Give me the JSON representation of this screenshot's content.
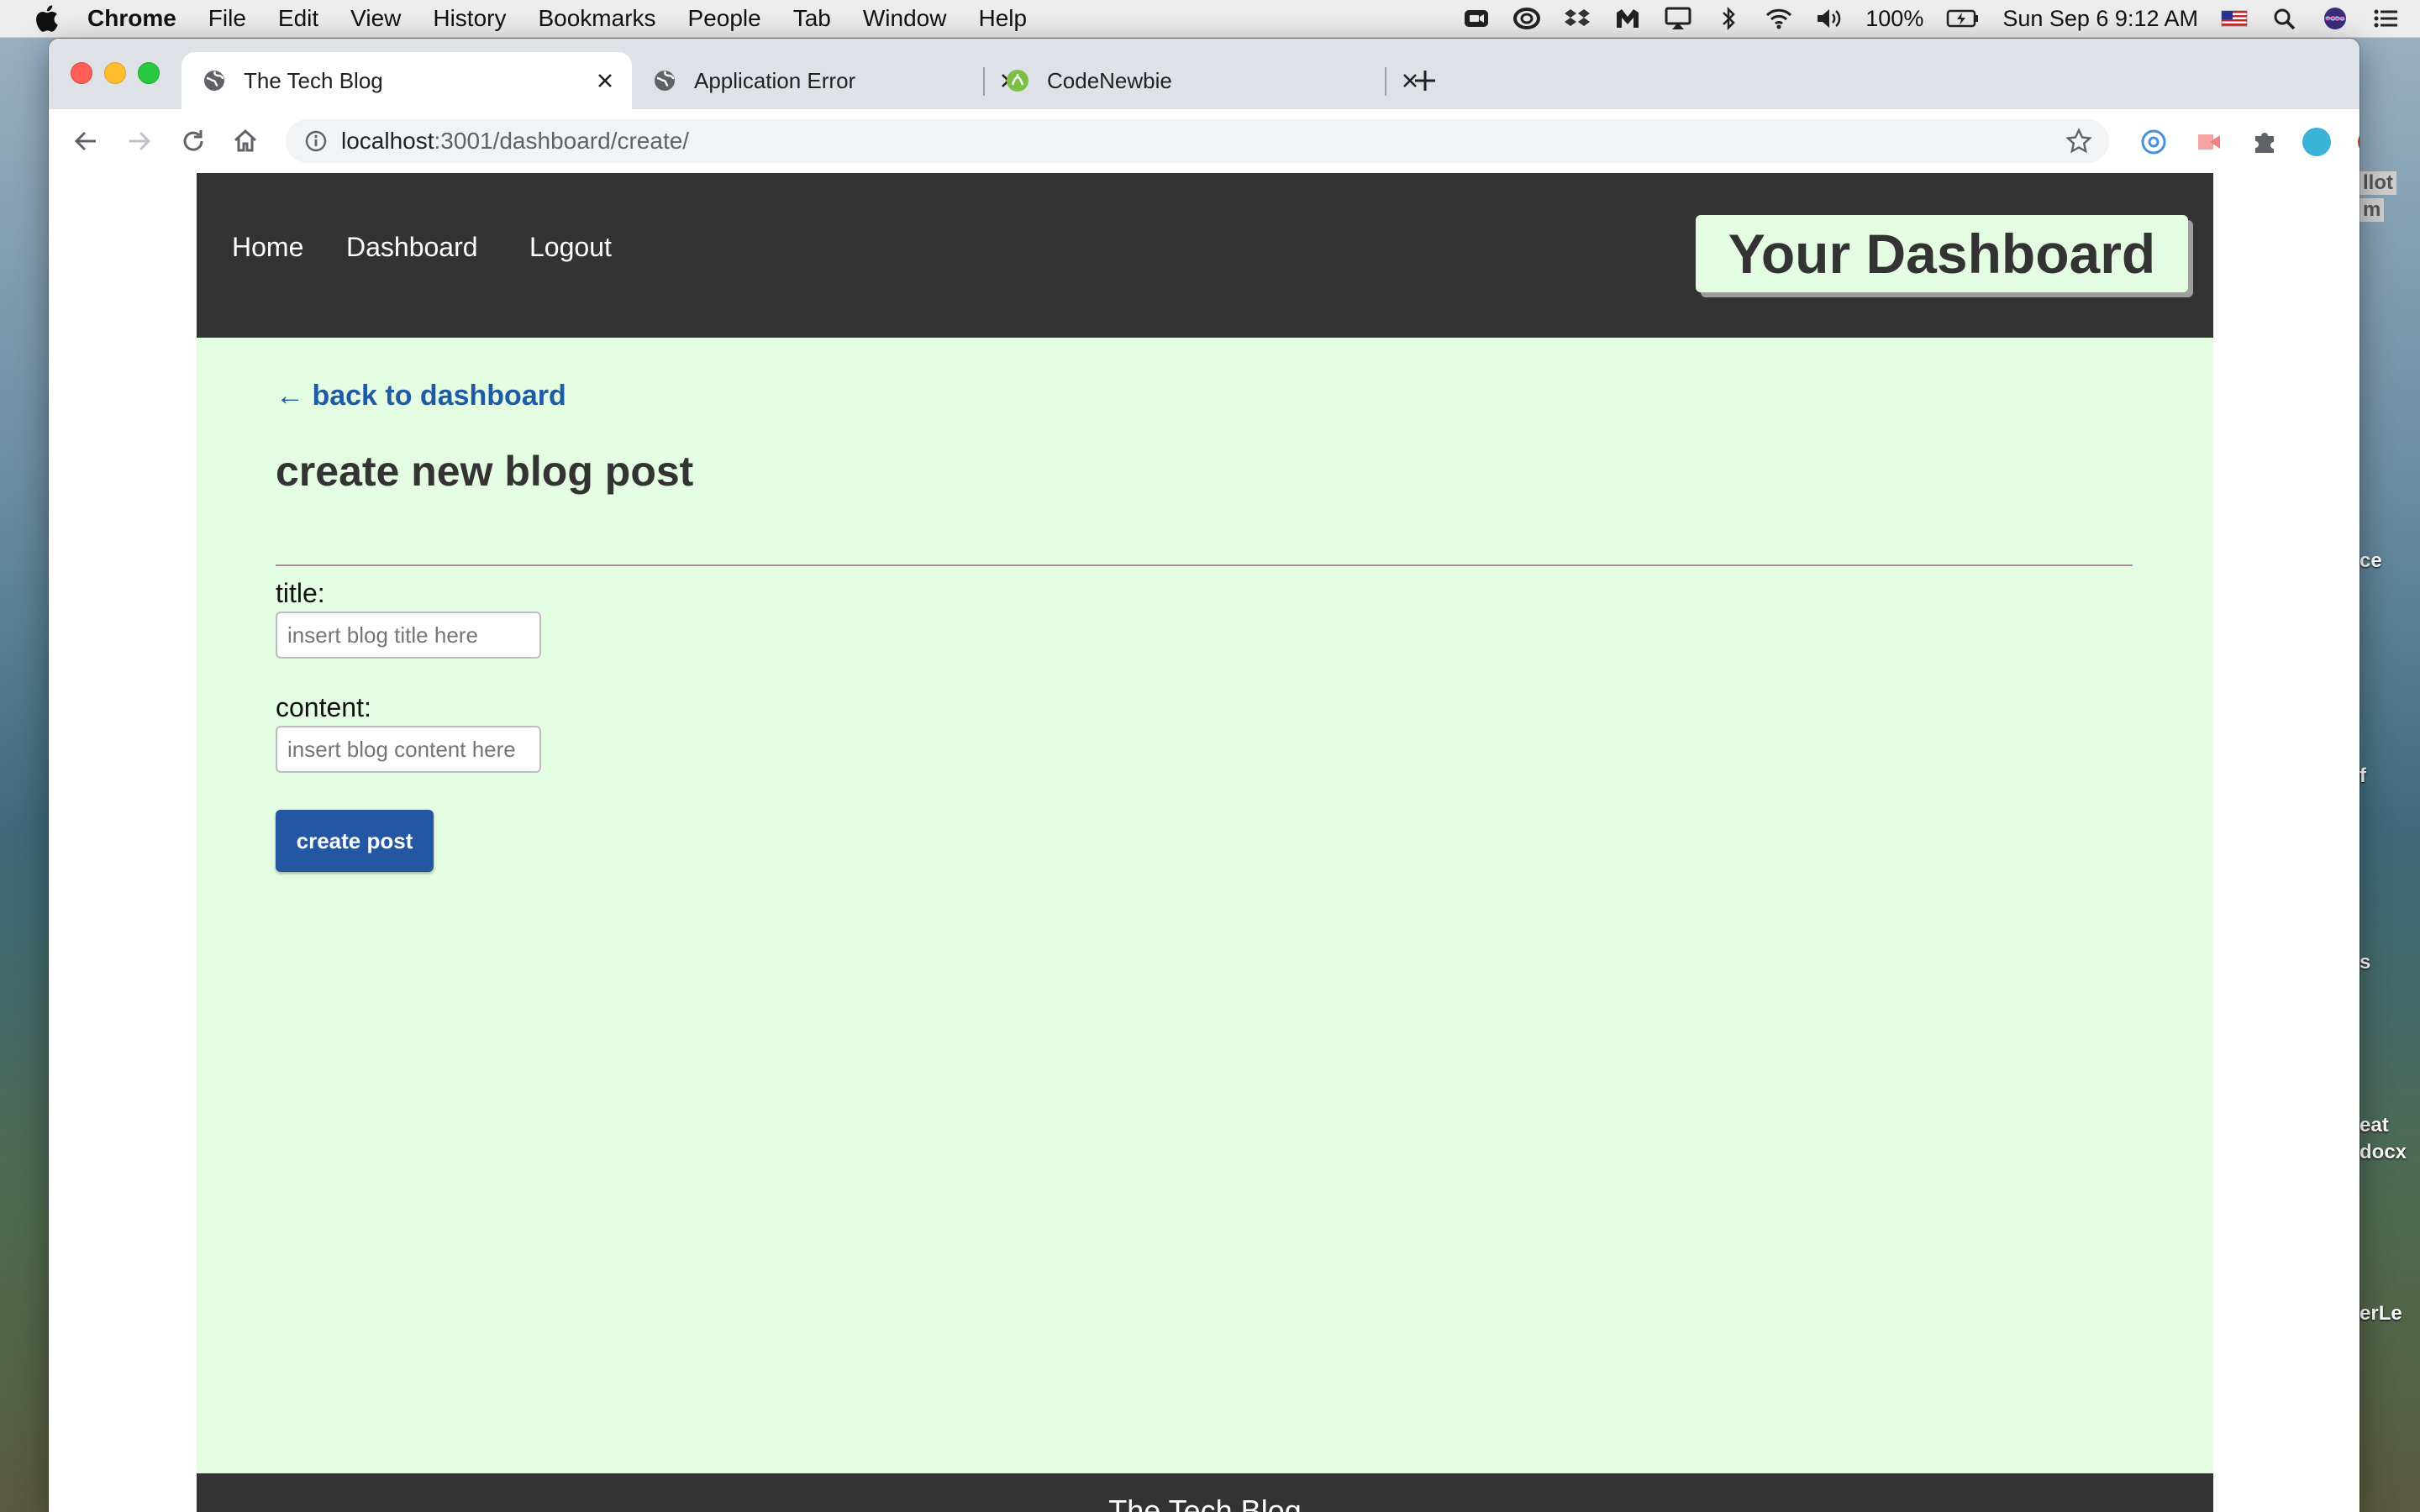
{
  "menubar": {
    "app_name": "Chrome",
    "items": [
      "File",
      "Edit",
      "View",
      "History",
      "Bookmarks",
      "People",
      "Tab",
      "Window",
      "Help"
    ],
    "battery": "100%",
    "clock": "Sun Sep 6  9:12 AM"
  },
  "desktop": {
    "labels": [
      "llot",
      "m",
      "ce",
      "f",
      "s",
      "eat",
      "docx",
      "erLe"
    ]
  },
  "browser": {
    "tabs": [
      {
        "title": "The Tech Blog",
        "icon": "globe-icon",
        "active": true
      },
      {
        "title": "Application Error",
        "icon": "globe-icon",
        "active": false
      },
      {
        "title": "CodeNewbie",
        "icon": "codenewbie-icon",
        "active": false
      }
    ],
    "url_host": "localhost",
    "url_rest": ":3001/dashboard/create/"
  },
  "site": {
    "nav": {
      "home": "Home",
      "dashboard": "Dashboard",
      "logout": "Logout"
    },
    "header_title": "Your Dashboard",
    "back_link": "← back to dashboard",
    "heading": "create new blog post",
    "form": {
      "title_label": "title:",
      "title_placeholder": "insert blog title here",
      "content_label": "content:",
      "content_placeholder": "insert blog content here",
      "submit_label": "create post"
    },
    "footer": "The Tech Blog"
  },
  "colors": {
    "header_bg": "#333333",
    "page_bg": "#e4fde2",
    "link": "#1f5aa6",
    "button": "#2357a2"
  }
}
